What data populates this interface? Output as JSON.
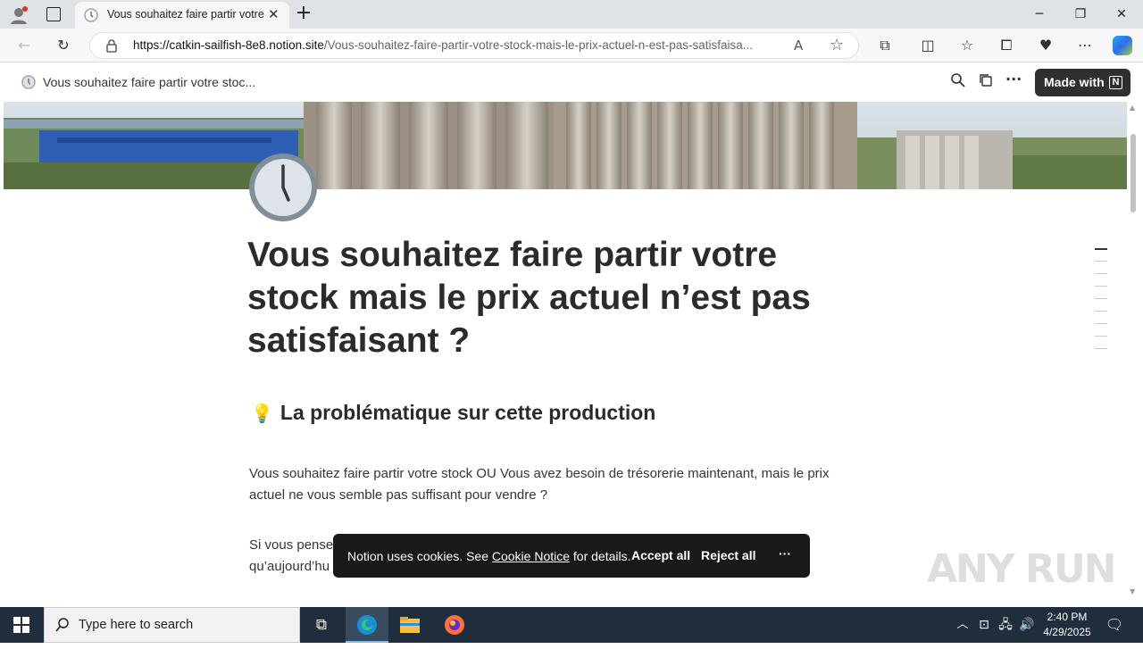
{
  "browser": {
    "tab_title": "Vous souhaitez faire partir votre s",
    "url_domain": "https://catkin-sailfish-8e8.notion.site",
    "url_path": "/Vous-souhaitez-faire-partir-votre-stock-mais-le-prix-actuel-n-est-pas-satisfaisa..."
  },
  "notion_bar": {
    "page_title": "Vous souhaitez faire partir votre stoc...",
    "made_with_label": "Made with"
  },
  "page": {
    "title": "Vous souhaitez faire partir votre stock mais le prix actuel n’est pas satisfaisant ?",
    "heading_emoji": "💡",
    "heading": "La problématique sur cette production",
    "paragraph1": "Vous souhaitez faire partir votre stock OU Vous avez besoin de trésorerie maintenant, mais le prix actuel ne vous semble pas suffisant pour vendre ?",
    "paragraph2_line1": "Si vous pense",
    "paragraph2_line2": "qu’aujourd’hu"
  },
  "cookie_banner": {
    "text_before": "Notion uses cookies. See ",
    "link": "Cookie Notice",
    "text_after": " for details.",
    "accept": "Accept all",
    "reject": "Reject all",
    "more": "···"
  },
  "taskbar": {
    "search_placeholder": "Type here to search",
    "time": "2:40 PM",
    "date": "4/29/2025"
  },
  "watermark": "ANY RUN"
}
